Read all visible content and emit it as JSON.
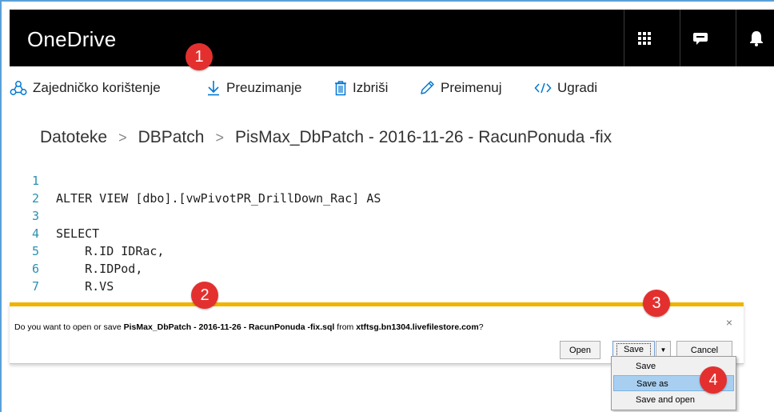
{
  "header": {
    "title": "OneDrive",
    "buttons": [
      {
        "name": "app-launcher-icon"
      },
      {
        "name": "feedback-icon"
      },
      {
        "name": "notifications-icon"
      }
    ]
  },
  "commands": [
    {
      "label": "Zajedničko korištenje",
      "icon": "share-icon"
    },
    {
      "label": "Preuzimanje",
      "icon": "download-icon"
    },
    {
      "label": "Izbriši",
      "icon": "trash-icon"
    },
    {
      "label": "Preimenuj",
      "icon": "pencil-icon"
    },
    {
      "label": "Ugradi",
      "icon": "embed-icon"
    }
  ],
  "breadcrumb": {
    "items": [
      "Datoteke",
      "DBPatch",
      "PisMax_DbPatch - 2016-11-26 - RacunPonuda -fix"
    ],
    "separator": ">"
  },
  "code": {
    "lines": [
      {
        "n": "1",
        "text": ""
      },
      {
        "n": "2",
        "text": "ALTER VIEW [dbo].[vwPivotPR_DrillDown_Rac] AS"
      },
      {
        "n": "3",
        "text": ""
      },
      {
        "n": "4",
        "text": "SELECT"
      },
      {
        "n": "5",
        "text": "    R.ID IDRac,"
      },
      {
        "n": "6",
        "text": "    R.IDPod,"
      },
      {
        "n": "7",
        "text": "    R.VS"
      }
    ]
  },
  "notification": {
    "prefix": "Do you want to open or save ",
    "filename": "PisMax_DbPatch - 2016-11-26 -  RacunPonuda -fix.sql",
    "middle": " from ",
    "host": "xtftsg.bn1304.livefilestore.com",
    "suffix": "?",
    "close": "×",
    "open_label": "Open",
    "save_label": "Save",
    "dropdown_arrow": "▼",
    "cancel_label": "Cancel"
  },
  "save_menu": {
    "items": [
      "Save",
      "Save as",
      "Save and open"
    ],
    "highlighted": "Save as"
  },
  "callouts": [
    "1",
    "2",
    "3",
    "4"
  ],
  "colors": {
    "header_bg": "#000000",
    "notification_accent": "#f0b400",
    "callout": "#e3302f",
    "line_number": "#2b91af",
    "command_icon": "#0078d4",
    "menu_highlight": "#a9cff0"
  }
}
